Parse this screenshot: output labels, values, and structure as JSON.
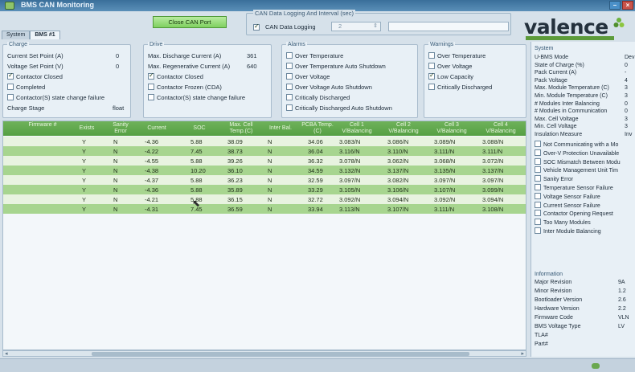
{
  "window": {
    "title": "BMS CAN Monitoring"
  },
  "toolbar": {
    "close_port_label": "Close CAN Port",
    "logging_group_title": "CAN Data Logging And Interval (sec)",
    "logging_check_label": "CAN Data Logging",
    "interval_value": "2",
    "logging_checked": true
  },
  "brand": {
    "logo_text": "valence"
  },
  "tabs": [
    {
      "label": "System",
      "active": false
    },
    {
      "label": "BMS #1",
      "active": true
    }
  ],
  "charge": {
    "title": "Charge",
    "current_set_point_label": "Current Set Point (A)",
    "current_set_point_value": "0",
    "voltage_set_point_label": "Voltage Set Point (V)",
    "voltage_set_point_value": "0",
    "contactor_closed_label": "Contactor Closed",
    "contactor_closed_checked": true,
    "completed_label": "Completed",
    "completed_checked": false,
    "state_change_failure_label": "Contactor(S) state change failure",
    "state_change_failure_checked": false,
    "charge_stage_label": "Charge Stage",
    "charge_stage_value": "float"
  },
  "drive": {
    "title": "Drive",
    "max_discharge_label": "Max. Discharge Current (A)",
    "max_discharge_value": "361",
    "max_regen_label": "Max. Regenerative Current (A)",
    "max_regen_value": "640",
    "contactor_closed_label": "Contactor Closed",
    "contactor_closed_checked": true,
    "contactor_frozen_label": "Contactor Frozen (CDA)",
    "contactor_frozen_checked": false,
    "state_change_failure_label": "Contactor(S) state change failure",
    "state_change_failure_checked": false
  },
  "alarms": {
    "title": "Alarms",
    "items": [
      {
        "label": "Over Temperature",
        "checked": false
      },
      {
        "label": "Over Temperature Auto Shutdown",
        "checked": false
      },
      {
        "label": "Over Voltage",
        "checked": false
      },
      {
        "label": "Over Voltage Auto Shutdown",
        "checked": false
      },
      {
        "label": "Critically Discharged",
        "checked": false
      },
      {
        "label": "Critically Discharged Auto Shutdown",
        "checked": false
      }
    ]
  },
  "warnings": {
    "title": "Warnings",
    "items": [
      {
        "label": "Over Temperature",
        "checked": false
      },
      {
        "label": "Over Voltage",
        "checked": false
      },
      {
        "label": "Low Capacity",
        "checked": true
      },
      {
        "label": "Critically Discharged",
        "checked": false
      }
    ]
  },
  "table": {
    "headers": [
      "Firmware #",
      "Exists",
      "Sanity Error",
      "Current",
      "SOC",
      "Max. Cell Temp.(C)",
      "Inter Bal.",
      "PCBA Temp.(C)",
      "Cell 1 V/Balancing",
      "Cell 2 V/Balancing",
      "Cell 3 V/Balancing",
      "Cell 4 V/Balancing"
    ],
    "rows": [
      {
        "firmware": "",
        "exists": "Y",
        "sanity": "N",
        "current": "-4.36",
        "soc": "5.88",
        "max_temp": "38.09",
        "inter_bal": "N",
        "pcba": "34.06",
        "c1": "3.083/N",
        "c2": "3.086/N",
        "c3": "3.089/N",
        "c4": "3.088/N"
      },
      {
        "firmware": "",
        "exists": "Y",
        "sanity": "N",
        "current": "-4.22",
        "soc": "7.45",
        "max_temp": "38.73",
        "inter_bal": "N",
        "pcba": "36.04",
        "c1": "3.116/N",
        "c2": "3.110/N",
        "c3": "3.111/N",
        "c4": "3.111/N"
      },
      {
        "firmware": "",
        "exists": "Y",
        "sanity": "N",
        "current": "-4.55",
        "soc": "5.88",
        "max_temp": "39.26",
        "inter_bal": "N",
        "pcba": "36.32",
        "c1": "3.078/N",
        "c2": "3.062/N",
        "c3": "3.068/N",
        "c4": "3.072/N"
      },
      {
        "firmware": "",
        "exists": "Y",
        "sanity": "N",
        "current": "-4.38",
        "soc": "10.20",
        "max_temp": "36.10",
        "inter_bal": "N",
        "pcba": "34.59",
        "c1": "3.132/N",
        "c2": "3.137/N",
        "c3": "3.135/N",
        "c4": "3.137/N"
      },
      {
        "firmware": "",
        "exists": "Y",
        "sanity": "N",
        "current": "-4.37",
        "soc": "5.88",
        "max_temp": "36.23",
        "inter_bal": "N",
        "pcba": "32.59",
        "c1": "3.097/N",
        "c2": "3.082/N",
        "c3": "3.097/N",
        "c4": "3.097/N"
      },
      {
        "firmware": "",
        "exists": "Y",
        "sanity": "N",
        "current": "-4.36",
        "soc": "5.88",
        "max_temp": "35.89",
        "inter_bal": "N",
        "pcba": "33.29",
        "c1": "3.105/N",
        "c2": "3.106/N",
        "c3": "3.107/N",
        "c4": "3.099/N"
      },
      {
        "firmware": "",
        "exists": "Y",
        "sanity": "N",
        "current": "-4.21",
        "soc": "5.88",
        "max_temp": "36.15",
        "inter_bal": "N",
        "pcba": "32.72",
        "c1": "3.092/N",
        "c2": "3.094/N",
        "c3": "3.092/N",
        "c4": "3.094/N"
      },
      {
        "firmware": "",
        "exists": "Y",
        "sanity": "N",
        "current": "-4.31",
        "soc": "7.45",
        "max_temp": "36.59",
        "inter_bal": "N",
        "pcba": "33.94",
        "c1": "3.113/N",
        "c2": "3.107/N",
        "c3": "3.111/N",
        "c4": "3.108/N"
      }
    ]
  },
  "system": {
    "title": "System",
    "fields": [
      {
        "label": "U-BMS Mode",
        "value": "Dev"
      },
      {
        "label": "State of Charge (%)",
        "value": "0"
      },
      {
        "label": "Pack Current (A)",
        "value": "-"
      },
      {
        "label": "Pack Voltage",
        "value": "4"
      },
      {
        "label": "Max. Module Temperature (C)",
        "value": "3"
      },
      {
        "label": "Min. Module Temperature (C)",
        "value": "3"
      },
      {
        "label": "# Modules Inter Balancing",
        "value": "0"
      },
      {
        "label": "# Modules in Communication",
        "value": "0"
      },
      {
        "label": "Max. Cell Voltage",
        "value": "3"
      },
      {
        "label": "Min. Cell Voltage",
        "value": "3"
      },
      {
        "label": "Insulation Measure",
        "value": "Inv"
      }
    ],
    "flags": [
      {
        "label": "Not Communicating with a Mo",
        "checked": false
      },
      {
        "label": "Over-V Protection Unavailable",
        "checked": false
      },
      {
        "label": "SOC Mismatch Between Modu",
        "checked": false
      },
      {
        "label": "Vehicle Management Unit Tim",
        "checked": false
      },
      {
        "label": "Sanity Error",
        "checked": false
      },
      {
        "label": "Temperature Sensor Failure",
        "checked": false
      },
      {
        "label": "Voltage Sensor Failure",
        "checked": false
      },
      {
        "label": "Current Sensor Failure",
        "checked": false
      },
      {
        "label": "Contactor Opening Request",
        "checked": false
      },
      {
        "label": "Too Many Modules",
        "checked": false
      },
      {
        "label": "Inter Module Balancing",
        "checked": false
      }
    ],
    "info_title": "Information",
    "info": [
      {
        "label": "Major Revision",
        "value": "9A"
      },
      {
        "label": "Minor Revision",
        "value": "1.2"
      },
      {
        "label": "Bootloader Version",
        "value": "2.6"
      },
      {
        "label": "Hardware Version",
        "value": "2.2"
      },
      {
        "label": "Firmware Code",
        "value": "VLN"
      },
      {
        "label": "BMS Voltage Type",
        "value": "LV"
      },
      {
        "label": "TLA#",
        "value": ""
      },
      {
        "label": "Part#",
        "value": ""
      }
    ]
  },
  "colors": {
    "header_green": "#55a043",
    "row_green": "#a7d58f",
    "brand_green": "#5c9b3a"
  }
}
